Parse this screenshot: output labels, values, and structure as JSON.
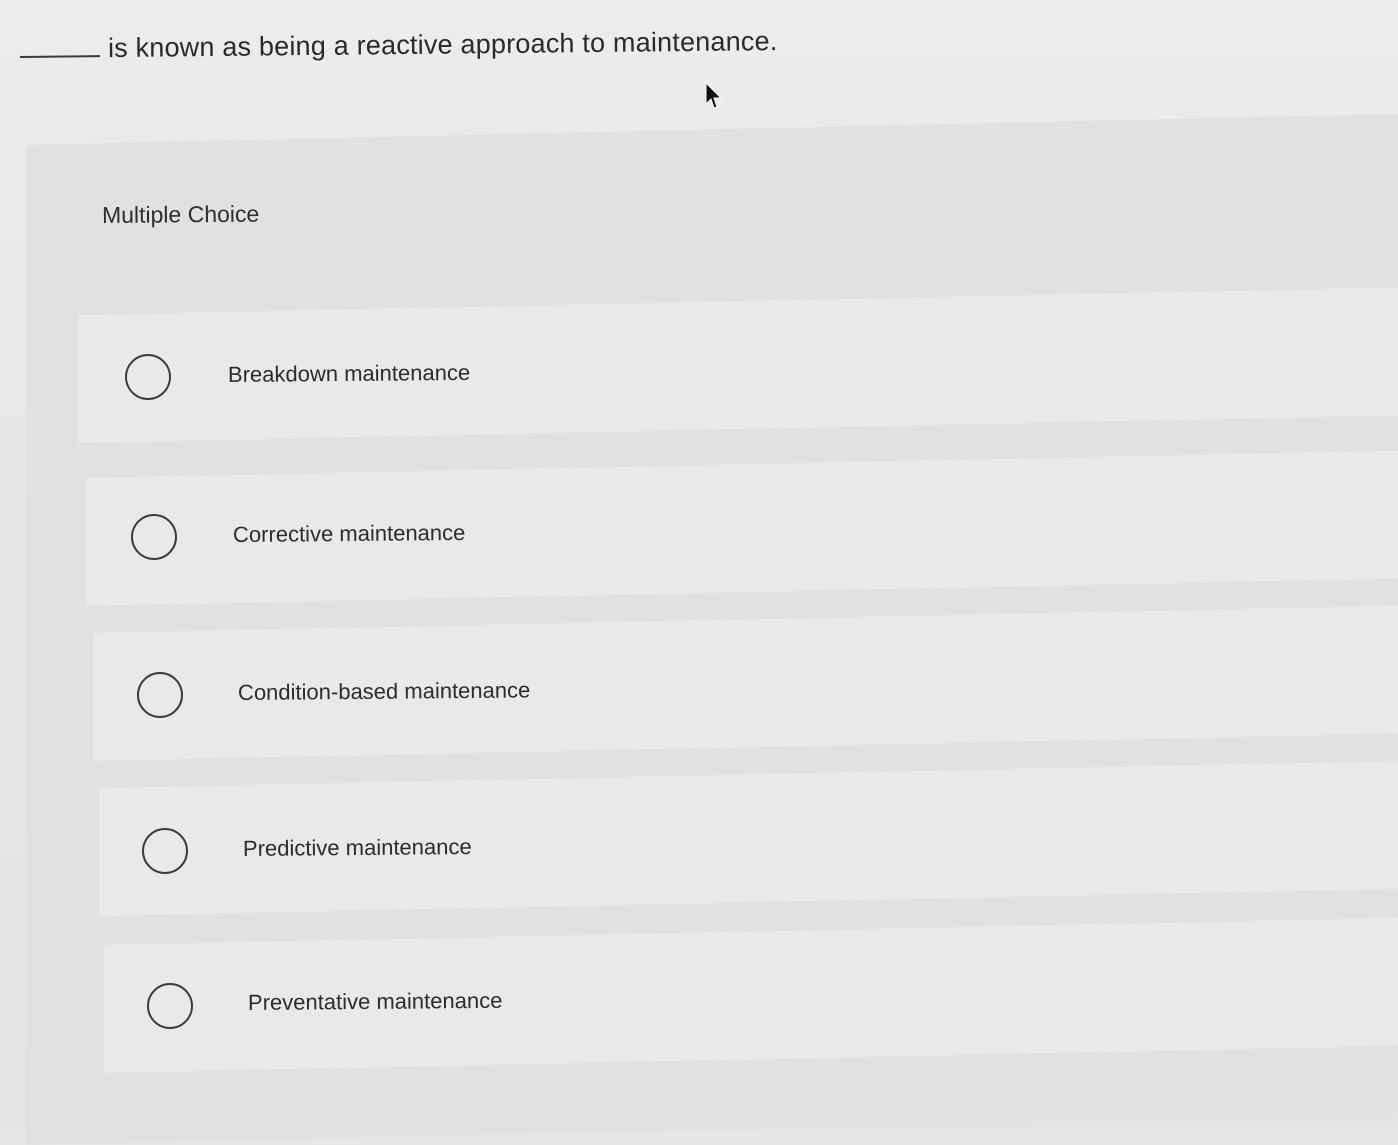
{
  "question": {
    "blank": "",
    "text": "is known as being a reactive approach to maintenance."
  },
  "panel": {
    "header": "Multiple Choice"
  },
  "options": [
    {
      "label": "Breakdown maintenance",
      "selected": false
    },
    {
      "label": "Corrective maintenance",
      "selected": false
    },
    {
      "label": "Condition-based maintenance",
      "selected": false
    },
    {
      "label": "Predictive maintenance",
      "selected": false
    },
    {
      "label": "Preventative maintenance",
      "selected": false
    }
  ],
  "icons": {
    "cursor": "mouse-pointer-icon",
    "radio": "radio-button-icon"
  },
  "colors": {
    "background": "#e6e6e4",
    "panel": "#e1e1df",
    "option_row": "#e9e9e7",
    "text": "#2b2b2b"
  }
}
